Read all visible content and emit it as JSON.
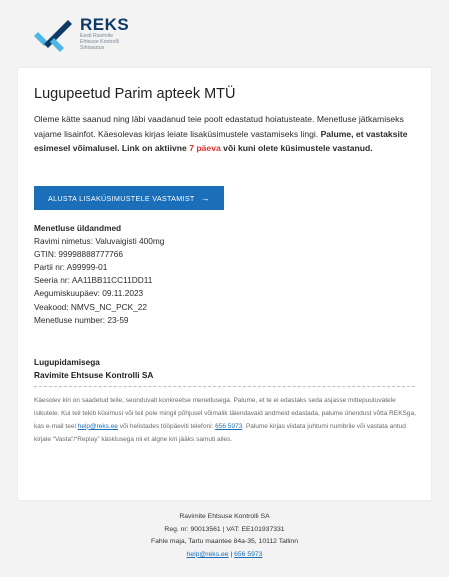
{
  "logo": {
    "name": "REKS",
    "subtitle_lines": [
      "Eesti Ravimite",
      "Ehtsuse Kontrolli",
      "Sihtasutus"
    ]
  },
  "email": {
    "title": "Lugupeetud Parim apteek MTÜ",
    "intro_plain": "Oleme kätte saanud ning läbi vaadanud teie poolt edastatud hoiatusteate. Menetluse jätkamiseks vajame lisainfot. Käesolevas kirjas leiate lisaküsimustele vastamiseks lingi. ",
    "intro_bold_1": "Palume, et vastaksite esimesel võimalusel. Link on aktiivne ",
    "intro_red": "7 päeva",
    "intro_bold_2": " või kuni olete küsimustele vastanud.",
    "cta_label": "ALUSTA LISAKÜSIMUSTELE VASTAMIST",
    "cta_arrow": "→",
    "details_heading": "Menetluse üldandmed",
    "details": [
      "Ravimi nimetus: Valuvaigisti 400mg",
      "GTIN: 99998888777766",
      "Partii nr: A99999-01",
      "Seeria nr: AA11BB11CC11DD11",
      "Aegumiskuupäev: 09.11.2023",
      "Veakood: NMVS_NC_PCK_22",
      "Menetluse number: 23-59"
    ],
    "sign_line1": "Lugupidamisega",
    "sign_line2": "Ravimite Ehtsuse Kontrolli SA",
    "disclaimer_part1": "Käesolev kiri on saadetud teile, seonduvalt konkreetse menetlusega. Palume, et te ei edastaks seda asjasse mittepuutuvatele isikutele. Kui teil tekib küsimusi või teil pole mingil põhjusel võimalik täiendavaid andmeid edastada, palume ühendust võtta REKSga, kas e-mail teel ",
    "disclaimer_email": "help@reks.ee",
    "disclaimer_part2": " või helistades tööpäeviti telefoni: ",
    "disclaimer_phone": "656 5973",
    "disclaimer_part3": ". Palume kirjas viidata juhtumi numbrile või vastata antud kirjale “Vasta”/“Replay” käsklusega nii et algne kiri jääks samuti alles."
  },
  "footer": {
    "org": "Ravimite Ehtsuse Kontrolli SA",
    "reg": "Reg. nr: 90013561 | VAT: EE101937331",
    "address": "Fahle maja, Tartu maantee 84a-35, 10112 Tallinn",
    "email": "help@reks.ee",
    "separator": " | ",
    "phone": "656 5973"
  },
  "colors": {
    "brand_navy": "#0e3b66",
    "brand_blue": "#1a6fb8",
    "logo_cyan": "#4fb7e6",
    "highlight_red": "#e0322b"
  },
  "icons": {
    "cta_arrow": "arrow-right-icon",
    "logo": "reks-logo-icon"
  }
}
